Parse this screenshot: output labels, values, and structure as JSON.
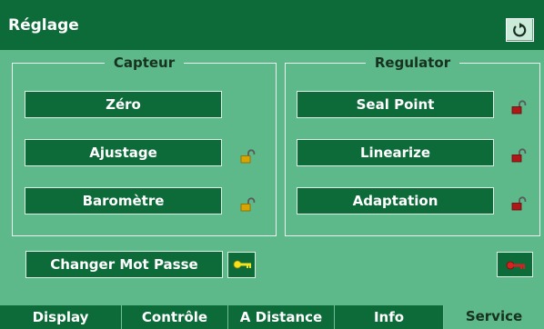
{
  "window": {
    "title": "Réglage",
    "refresh_icon": "refresh-icon"
  },
  "capteur": {
    "legend": "Capteur",
    "buttons": [
      {
        "label": "Zéro",
        "lock": "none"
      },
      {
        "label": "Ajustage",
        "lock": "unlocked-yellow"
      },
      {
        "label": "Baromètre",
        "lock": "unlocked-yellow"
      }
    ]
  },
  "regulator": {
    "legend": "Regulator",
    "buttons": [
      {
        "label": "Seal Point",
        "lock": "unlocked-red"
      },
      {
        "label": "Linearize",
        "lock": "unlocked-red"
      },
      {
        "label": "Adaptation",
        "lock": "unlocked-red"
      }
    ]
  },
  "bottom": {
    "change_password_label": "Changer Mot Passe",
    "key_icon": "yellow-key-icon",
    "red_key_icon": "red-key-icon"
  },
  "tabs": [
    {
      "label": "Display",
      "active": false
    },
    {
      "label": "Contrôle",
      "active": false
    },
    {
      "label": "A Distance",
      "active": false
    },
    {
      "label": "Info",
      "active": false
    },
    {
      "label": "Service",
      "active": true
    }
  ],
  "colors": {
    "panel_bg": "#5db98a",
    "dark_green": "#0c6b39",
    "lock_yellow": "#d9a400",
    "lock_red": "#b01818",
    "key_yellow": "#f3e21c",
    "key_red": "#d42222"
  }
}
